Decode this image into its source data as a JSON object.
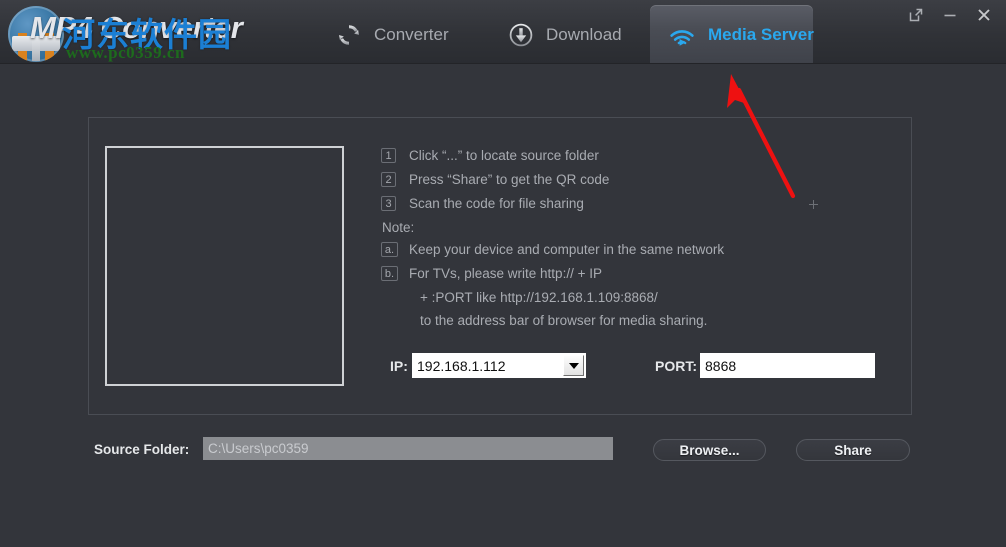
{
  "window": {
    "title": "MP4 Converter",
    "watermark_cn": "河东软件园",
    "watermark_url": "www.pc0359.cn",
    "controls": {
      "restore": "restore-icon",
      "minimize": "minimize-icon",
      "close": "close-icon"
    }
  },
  "nav": {
    "tabs": [
      {
        "label": "Converter",
        "icon": "refresh-icon",
        "active": false
      },
      {
        "label": "Download",
        "icon": "download-icon",
        "active": false
      },
      {
        "label": "Media Server",
        "icon": "cast-icon",
        "active": true
      }
    ]
  },
  "panel": {
    "qr_placeholder": "",
    "steps": [
      {
        "num": "1",
        "text": "Click “...” to locate source folder"
      },
      {
        "num": "2",
        "text": "Press “Share” to get the QR code"
      },
      {
        "num": "3",
        "text": "Scan the code for file sharing"
      }
    ],
    "note_label": "Note:",
    "notes": [
      {
        "letter": "a.",
        "text": "Keep your device and computer in the same network",
        "continuation": []
      },
      {
        "letter": "b.",
        "text": "For TVs, please write http:// + IP",
        "continuation": [
          "+ :PORT like http://192.168.1.109:8868/",
          "to the address bar of browser for media sharing."
        ]
      }
    ],
    "ip": {
      "label": "IP:",
      "value": "192.168.1.112"
    },
    "port": {
      "label": "PORT:",
      "value": "8868"
    }
  },
  "bottom": {
    "source_folder_label": "Source Folder:",
    "source_folder_value": "C:\\Users\\pc0359",
    "browse_label": "Browse...",
    "share_label": "Share"
  },
  "colors": {
    "background": "#33353b",
    "header_top": "#3c3e44",
    "accent_cyan": "#2aa8ee",
    "annotation_red": "#ee1111",
    "watermark_blue": "#1b7fd4",
    "watermark_green": "#1d6b1d",
    "field_white": "#ffffff",
    "source_field_gray": "#8b8d91"
  },
  "annotation": {
    "arrow": "red-arrow-pointing-to-media-server-tab"
  }
}
